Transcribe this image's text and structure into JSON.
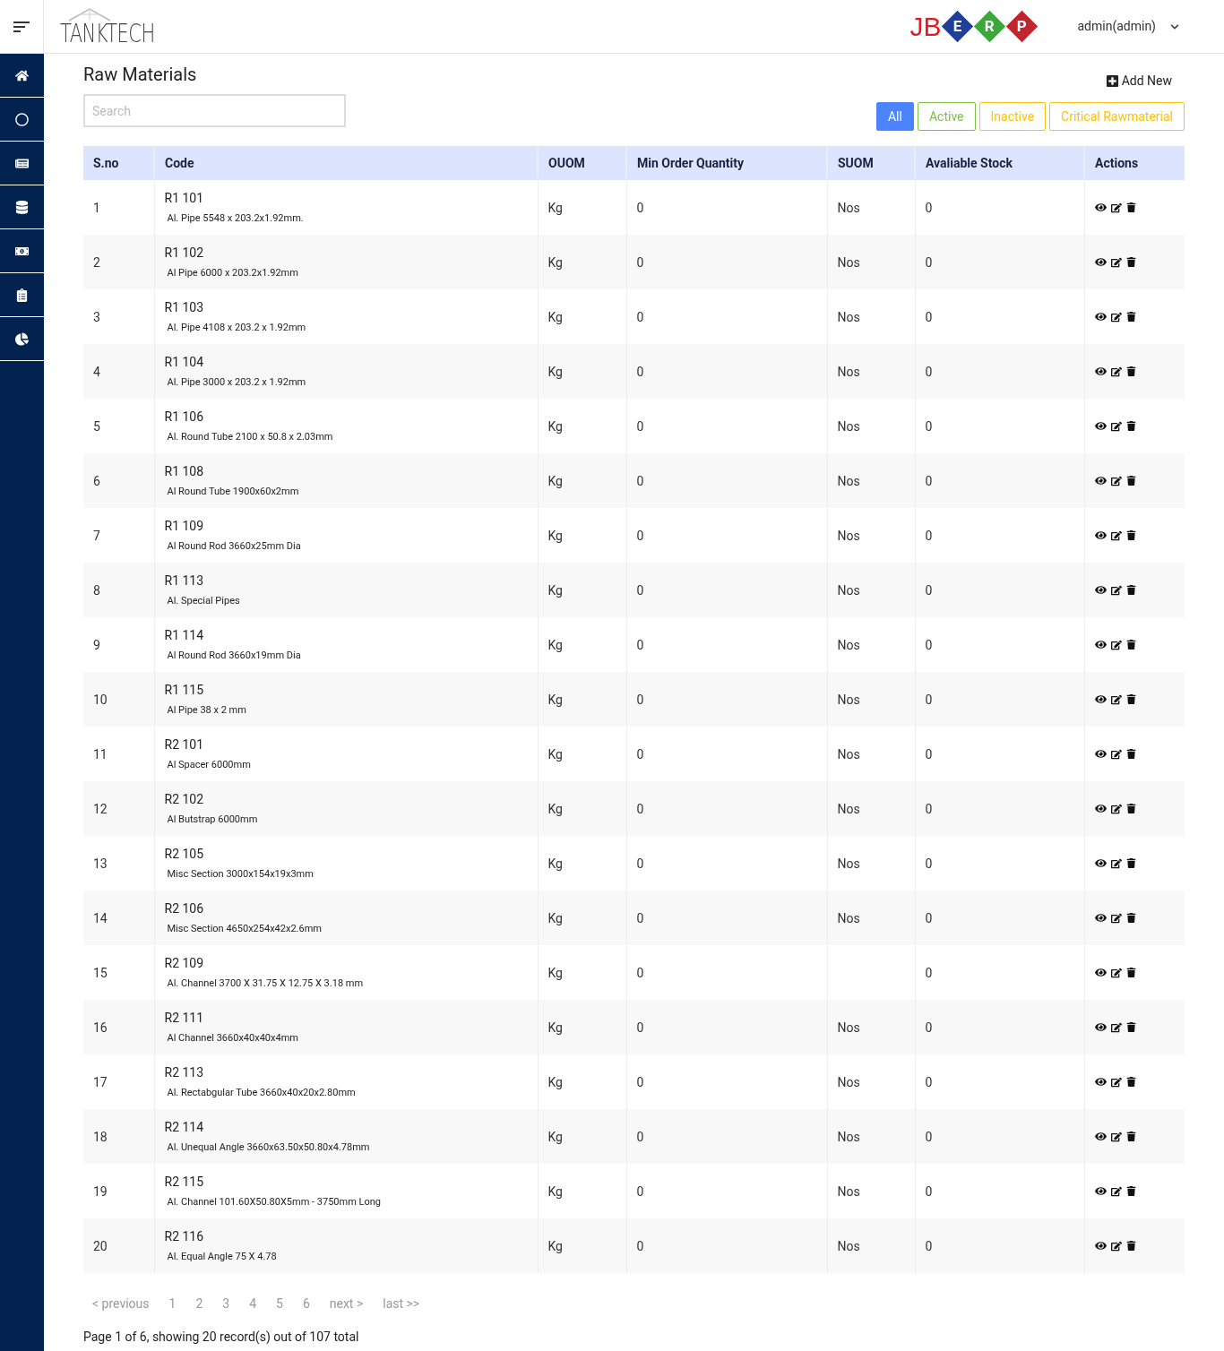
{
  "header": {
    "brand": "TANKTECH",
    "erp_logo": {
      "prefix": "JB",
      "letters": [
        {
          "letter": "E",
          "color": "#1f3f99"
        },
        {
          "letter": "R",
          "color": "#3aa93a"
        },
        {
          "letter": "P",
          "color": "#c0262d"
        }
      ]
    },
    "user": "admin(admin)"
  },
  "page": {
    "title": "Raw Materials",
    "add_new": "Add New",
    "search": {
      "placeholder": "Search"
    },
    "filters": [
      {
        "label": "All",
        "selected": true,
        "color": "#4c84ff"
      },
      {
        "label": "Active",
        "selected": false,
        "color": "#7cc142"
      },
      {
        "label": "Inactive",
        "selected": false,
        "color": "#ffc107"
      },
      {
        "label": "Critical Rawmaterial",
        "selected": false,
        "color": "#ffc107"
      }
    ]
  },
  "table": {
    "columns": [
      "S.no",
      "Code",
      "OUOM",
      "Min Order Quantity",
      "SUOM",
      "Avaliable Stock",
      "Actions"
    ],
    "rows": [
      {
        "sno": "1",
        "code": "R1 101",
        "description": "Al. Pipe 5548 x 203.2x1.92mm.",
        "ouom": "Kg",
        "min_qty": "0",
        "suom": "Nos",
        "stock": "0"
      },
      {
        "sno": "2",
        "code": "R1 102",
        "description": "Al Pipe 6000 x 203.2x1.92mm",
        "ouom": "Kg",
        "min_qty": "0",
        "suom": "Nos",
        "stock": "0"
      },
      {
        "sno": "3",
        "code": "R1 103",
        "description": "Al. Pipe 4108 x 203.2 x 1.92mm",
        "ouom": "Kg",
        "min_qty": "0",
        "suom": "Nos",
        "stock": "0"
      },
      {
        "sno": "4",
        "code": "R1 104",
        "description": "Al. Pipe 3000 x 203.2 x 1.92mm",
        "ouom": "Kg",
        "min_qty": "0",
        "suom": "Nos",
        "stock": "0"
      },
      {
        "sno": "5",
        "code": "R1 106",
        "description": "Al. Round Tube 2100 x 50.8 x 2.03mm",
        "ouom": "Kg",
        "min_qty": "0",
        "suom": "Nos",
        "stock": "0"
      },
      {
        "sno": "6",
        "code": "R1 108",
        "description": "Al Round Tube 1900x60x2mm",
        "ouom": "Kg",
        "min_qty": "0",
        "suom": "Nos",
        "stock": "0"
      },
      {
        "sno": "7",
        "code": "R1 109",
        "description": "Al Round Rod 3660x25mm Dia",
        "ouom": "Kg",
        "min_qty": "0",
        "suom": "Nos",
        "stock": "0"
      },
      {
        "sno": "8",
        "code": "R1 113",
        "description": "Al. Special Pipes",
        "ouom": "Kg",
        "min_qty": "0",
        "suom": "Nos",
        "stock": "0"
      },
      {
        "sno": "9",
        "code": "R1 114",
        "description": "Al Round Rod 3660x19mm Dia",
        "ouom": "Kg",
        "min_qty": "0",
        "suom": "Nos",
        "stock": "0"
      },
      {
        "sno": "10",
        "code": "R1 115",
        "description": "Al Pipe 38 x 2 mm",
        "ouom": "Kg",
        "min_qty": "0",
        "suom": "Nos",
        "stock": "0"
      },
      {
        "sno": "11",
        "code": "R2 101",
        "description": "Al Spacer 6000mm",
        "ouom": "Kg",
        "min_qty": "0",
        "suom": "Nos",
        "stock": "0"
      },
      {
        "sno": "12",
        "code": "R2 102",
        "description": "Al Butstrap 6000mm",
        "ouom": "Kg",
        "min_qty": "0",
        "suom": "Nos",
        "stock": "0"
      },
      {
        "sno": "13",
        "code": "R2 105",
        "description": "Misc Section 3000x154x19x3mm",
        "ouom": "Kg",
        "min_qty": "0",
        "suom": "Nos",
        "stock": "0"
      },
      {
        "sno": "14",
        "code": "R2 106",
        "description": "Misc Section 4650x254x42x2.6mm",
        "ouom": "Kg",
        "min_qty": "0",
        "suom": "Nos",
        "stock": "0"
      },
      {
        "sno": "15",
        "code": "R2 109",
        "description": "Al. Channel 3700 X 31.75 X 12.75 X 3.18 mm",
        "ouom": "Kg",
        "min_qty": "0",
        "stock": "0"
      },
      {
        "sno": "16",
        "code": "R2 111",
        "description": "Al Channel 3660x40x40x4mm",
        "ouom": "Kg",
        "min_qty": "0",
        "suom": "Nos",
        "stock": "0"
      },
      {
        "sno": "17",
        "code": "R2 113",
        "description": "Al. Rectabgular Tube 3660x40x20x2.80mm",
        "ouom": "Kg",
        "min_qty": "0",
        "suom": "Nos",
        "stock": "0"
      },
      {
        "sno": "18",
        "code": "R2 114",
        "description": "Al. Unequal Angle 3660x63.50x50.80x4.78mm",
        "ouom": "Kg",
        "min_qty": "0",
        "suom": "Nos",
        "stock": "0"
      },
      {
        "sno": "19",
        "code": "R2 115",
        "description": "Al. Channel 101.60X50.80X5mm - 3750mm Long",
        "ouom": "Kg",
        "min_qty": "0",
        "suom": "Nos",
        "stock": "0"
      },
      {
        "sno": "20",
        "code": "R2 116",
        "description": "Al. Equal Angle 75 X 4.78",
        "ouom": "Kg",
        "min_qty": "0",
        "suom": "Nos",
        "stock": "0"
      }
    ]
  },
  "pagination": {
    "items": [
      "< previous",
      "1",
      "2",
      "3",
      "4",
      "5",
      "6",
      "next >",
      "last >>"
    ],
    "summary": "Page 1 of 6, showing 20 record(s) out of 107 total"
  }
}
